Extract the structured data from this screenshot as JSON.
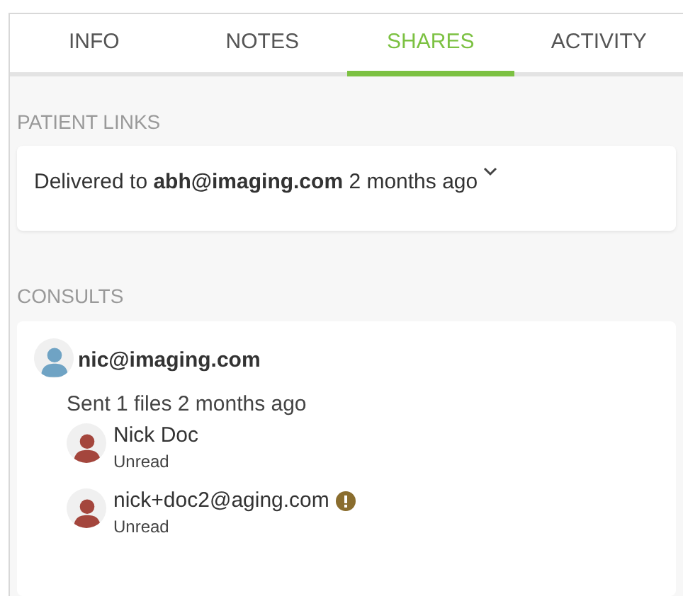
{
  "tabs": [
    {
      "label": "INFO",
      "selected": false
    },
    {
      "label": "NOTES",
      "selected": false
    },
    {
      "label": "SHARES",
      "selected": true
    },
    {
      "label": "ACTIVITY",
      "selected": false
    }
  ],
  "patient_links": {
    "title": "PATIENT LINKS",
    "items": [
      {
        "text": "Delivered to **abh@imaging.com** 2 months ago",
        "expanded": false
      }
    ]
  },
  "consults": {
    "title": "CONSULTS",
    "items": [
      {
        "sender": "nic@imaging.com",
        "summary": "Sent 1 files 2 months ago",
        "recipients": [
          {
            "name": "Nick Doc",
            "status": "Unread",
            "warning": false
          },
          {
            "name": "nick+doc2@aging.com",
            "status": "Unread",
            "warning": true
          }
        ]
      }
    ]
  }
}
